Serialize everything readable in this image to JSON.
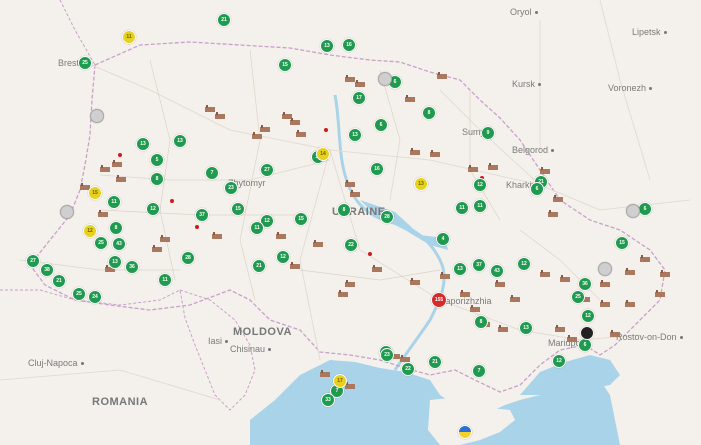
{
  "map": {
    "labels": {
      "countries": [
        "UKRAINE",
        "MOLDOVA",
        "ROMANIA"
      ],
      "cities": [
        "Oryol",
        "Lipetsk",
        "Kursk",
        "Voronezh",
        "Brest",
        "Sumy",
        "Belgorod",
        "Kharkiv",
        "Zhytomyr",
        "Zaporizhzhia",
        "Mariupol",
        "Rostov-on-Don",
        "Iasi",
        "Chisinau",
        "Cluj-Napoca"
      ]
    },
    "markers": [
      {
        "label": "21",
        "color": "green"
      },
      {
        "label": "13",
        "color": "green"
      },
      {
        "label": "16",
        "color": "green"
      },
      {
        "label": "25",
        "color": "green"
      },
      {
        "label": "15",
        "color": "green"
      },
      {
        "label": "6",
        "color": "green"
      },
      {
        "label": "17",
        "color": "green"
      },
      {
        "label": "6",
        "color": "green"
      },
      {
        "label": "8",
        "color": "green"
      },
      {
        "label": "9",
        "color": "green"
      },
      {
        "label": "13",
        "color": "green"
      },
      {
        "label": "5",
        "color": "green"
      },
      {
        "label": "8",
        "color": "green"
      },
      {
        "label": "13",
        "color": "green"
      },
      {
        "label": "11",
        "color": "green"
      },
      {
        "label": "12",
        "color": "green"
      },
      {
        "label": "37",
        "color": "green"
      },
      {
        "label": "23",
        "color": "green"
      },
      {
        "label": "15",
        "color": "green"
      },
      {
        "label": "12",
        "color": "green"
      },
      {
        "label": "8",
        "color": "green"
      },
      {
        "label": "11",
        "color": "green"
      },
      {
        "label": "25",
        "color": "green"
      },
      {
        "label": "43",
        "color": "green"
      },
      {
        "label": "21",
        "color": "green"
      },
      {
        "label": "13",
        "color": "green"
      },
      {
        "label": "12",
        "color": "green"
      },
      {
        "label": "15",
        "color": "green"
      },
      {
        "label": "7",
        "color": "green"
      },
      {
        "label": "8",
        "color": "green"
      },
      {
        "label": "16",
        "color": "green"
      },
      {
        "label": "22",
        "color": "green"
      },
      {
        "label": "28",
        "color": "green"
      },
      {
        "label": "12",
        "color": "green"
      },
      {
        "label": "21",
        "color": "green"
      },
      {
        "label": "13",
        "color": "green"
      },
      {
        "label": "37",
        "color": "green"
      },
      {
        "label": "43",
        "color": "green"
      },
      {
        "label": "6",
        "color": "green"
      },
      {
        "label": "4",
        "color": "green"
      },
      {
        "label": "22",
        "color": "green"
      },
      {
        "label": "7",
        "color": "green"
      },
      {
        "label": "21",
        "color": "green"
      },
      {
        "label": "12",
        "color": "green"
      },
      {
        "label": "6",
        "color": "green"
      },
      {
        "label": "12",
        "color": "green"
      },
      {
        "label": "15",
        "color": "green"
      },
      {
        "label": "27",
        "color": "green"
      },
      {
        "label": "38",
        "color": "green"
      },
      {
        "label": "21",
        "color": "green"
      },
      {
        "label": "25",
        "color": "green"
      },
      {
        "label": "24",
        "color": "green"
      },
      {
        "label": "11",
        "color": "green"
      },
      {
        "label": "36",
        "color": "green"
      },
      {
        "label": "27",
        "color": "green"
      },
      {
        "label": "13",
        "color": "green"
      },
      {
        "label": "28",
        "color": "green"
      },
      {
        "label": "23",
        "color": "green"
      },
      {
        "label": "7",
        "color": "green"
      },
      {
        "label": "33",
        "color": "green"
      },
      {
        "label": "22",
        "color": "green"
      },
      {
        "label": "13",
        "color": "green"
      },
      {
        "label": "17",
        "color": "green"
      },
      {
        "label": "8",
        "color": "green"
      },
      {
        "label": "6",
        "color": "green"
      },
      {
        "label": "12",
        "color": "green"
      },
      {
        "label": "11",
        "color": "green"
      },
      {
        "label": "11",
        "color": "green"
      },
      {
        "label": "25",
        "color": "green"
      },
      {
        "label": "36",
        "color": "green"
      },
      {
        "label": "11",
        "color": "yellow"
      },
      {
        "label": "15",
        "color": "yellow"
      },
      {
        "label": "12",
        "color": "yellow"
      },
      {
        "label": "14",
        "color": "yellow"
      },
      {
        "label": "13",
        "color": "yellow"
      },
      {
        "label": "17",
        "color": "yellow"
      },
      {
        "label": "155",
        "color": "red"
      },
      {
        "label": "",
        "color": "gray"
      },
      {
        "label": "",
        "color": "gray"
      },
      {
        "label": "",
        "color": "gray"
      },
      {
        "label": "",
        "color": "gray"
      },
      {
        "label": "",
        "color": "gray"
      },
      {
        "label": "",
        "color": "dark"
      }
    ],
    "flag_icon": "ukraine-flag-icon",
    "colors": {
      "green": "#1f9a4f",
      "yellow": "#e6d11d",
      "red": "#d62b2b",
      "gray": "#cfcfcf",
      "dark": "#222222",
      "land": "#f4f1ec",
      "sea": "#a9d3e8"
    }
  }
}
